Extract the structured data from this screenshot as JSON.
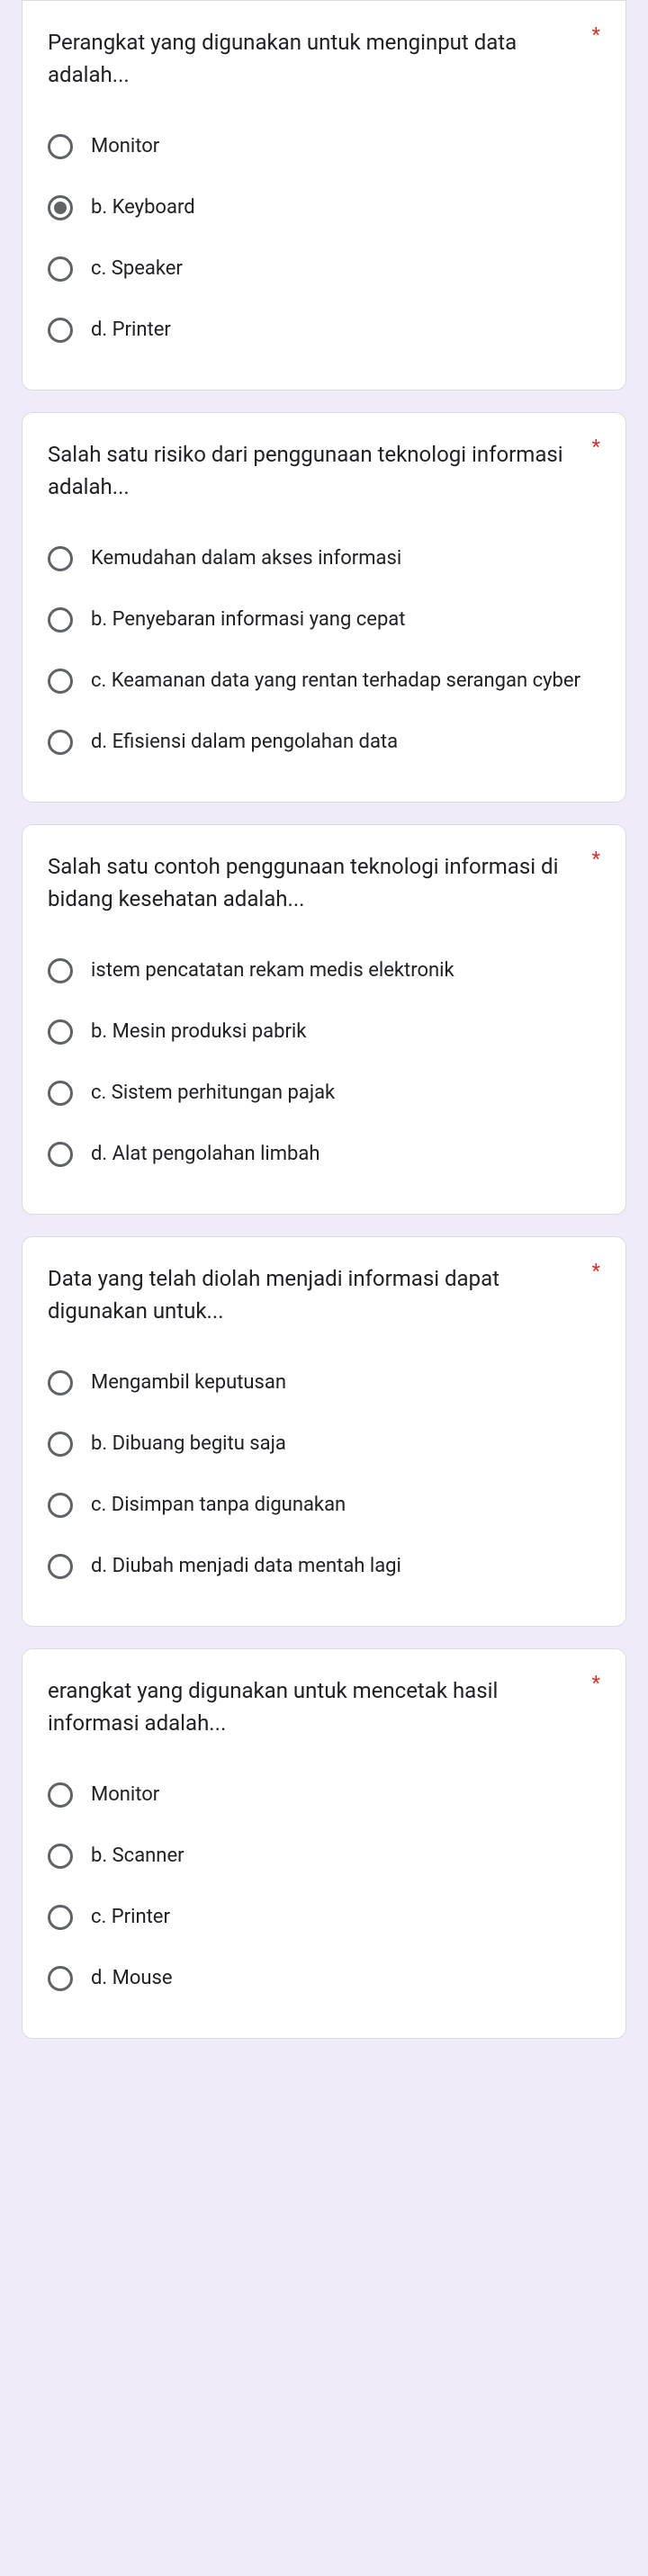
{
  "required_marker": "*",
  "questions": [
    {
      "text": " Perangkat yang digunakan untuk menginput data adalah...",
      "required": true,
      "options": [
        {
          "label": "Monitor",
          "selected": false
        },
        {
          "label": "b. Keyboard",
          "selected": true
        },
        {
          "label": "c. Speaker",
          "selected": false
        },
        {
          "label": "d. Printer",
          "selected": false
        }
      ]
    },
    {
      "text": " Salah satu risiko dari penggunaan teknologi informasi adalah...",
      "required": true,
      "options": [
        {
          "label": "Kemudahan dalam akses informasi",
          "selected": false
        },
        {
          "label": "b. Penyebaran informasi yang cepat",
          "selected": false
        },
        {
          "label": "c. Keamanan data yang rentan terhadap serangan cyber",
          "selected": false
        },
        {
          "label": "d. Efisiensi dalam pengolahan data",
          "selected": false
        }
      ]
    },
    {
      "text": "Salah satu contoh penggunaan teknologi informasi di bidang kesehatan adalah...",
      "required": true,
      "options": [
        {
          "label": "istem pencatatan rekam medis elektronik",
          "selected": false
        },
        {
          "label": "b. Mesin produksi pabrik",
          "selected": false
        },
        {
          "label": "c. Sistem perhitungan pajak",
          "selected": false
        },
        {
          "label": "d. Alat pengolahan limbah",
          "selected": false
        }
      ]
    },
    {
      "text": "Data yang telah diolah menjadi informasi dapat digunakan untuk...",
      "required": true,
      "options": [
        {
          "label": "Mengambil keputusan",
          "selected": false
        },
        {
          "label": "b. Dibuang begitu saja",
          "selected": false
        },
        {
          "label": "c. Disimpan tanpa digunakan",
          "selected": false
        },
        {
          "label": "d. Diubah menjadi data mentah lagi",
          "selected": false
        }
      ]
    },
    {
      "text": "erangkat yang digunakan untuk mencetak hasil informasi adalah...",
      "required": true,
      "options": [
        {
          "label": "Monitor",
          "selected": false
        },
        {
          "label": "b. Scanner",
          "selected": false
        },
        {
          "label": "c. Printer",
          "selected": false
        },
        {
          "label": "d. Mouse",
          "selected": false
        }
      ]
    }
  ]
}
